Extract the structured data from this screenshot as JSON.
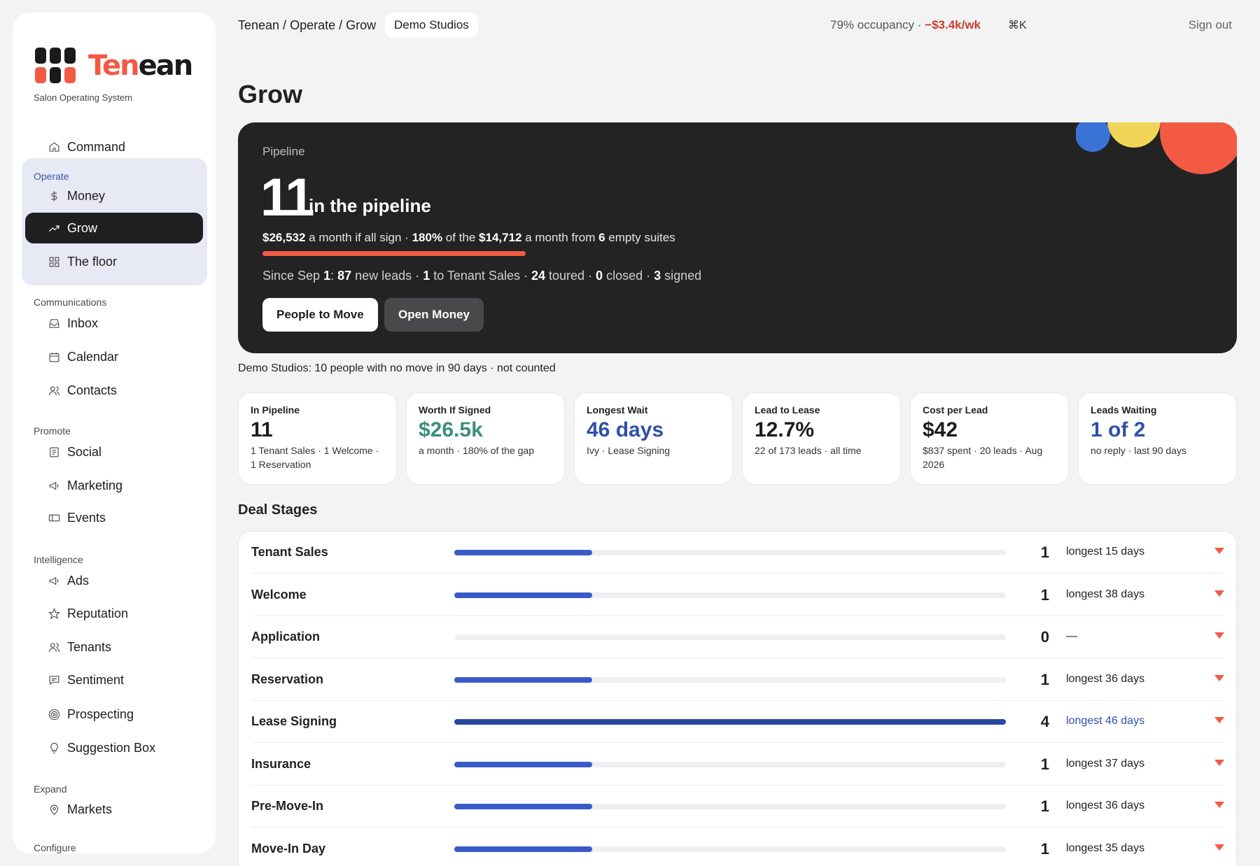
{
  "brand": {
    "name_part1": "Ten",
    "name_part2": "ean",
    "tagline": "Salon Operating System"
  },
  "sidebar": {
    "top_item": {
      "label": "Command",
      "icon": "home-icon"
    },
    "sections": [
      {
        "label": "Operate",
        "items": [
          {
            "label": "Money",
            "icon": "dollar-icon"
          },
          {
            "label": "Grow",
            "icon": "trending-up-icon",
            "active": true
          },
          {
            "label": "The floor",
            "icon": "grid-icon"
          }
        ]
      },
      {
        "label": "Communications",
        "items": [
          {
            "label": "Inbox",
            "icon": "inbox-icon"
          },
          {
            "label": "Calendar",
            "icon": "calendar-icon"
          },
          {
            "label": "Contacts",
            "icon": "users-icon"
          }
        ]
      },
      {
        "label": "Promote",
        "items": [
          {
            "label": "Social",
            "icon": "document-icon"
          },
          {
            "label": "Marketing",
            "icon": "megaphone-icon"
          },
          {
            "label": "Events",
            "icon": "ticket-icon"
          }
        ]
      },
      {
        "label": "Intelligence",
        "items": [
          {
            "label": "Ads",
            "icon": "megaphone-icon"
          },
          {
            "label": "Reputation",
            "icon": "star-icon"
          },
          {
            "label": "Tenants",
            "icon": "users-icon"
          },
          {
            "label": "Sentiment",
            "icon": "chat-icon"
          },
          {
            "label": "Prospecting",
            "icon": "target-icon"
          },
          {
            "label": "Suggestion Box",
            "icon": "lightbulb-icon"
          }
        ]
      },
      {
        "label": "Expand",
        "items": [
          {
            "label": "Markets",
            "icon": "map-pin-icon"
          }
        ]
      },
      {
        "label": "Configure",
        "items": []
      }
    ]
  },
  "topbar": {
    "crumb_root": "Tenean / ",
    "crumb_mid": "Operate / Grow",
    "studio": "Demo Studios",
    "occupancy": "79% occupancy · ",
    "weekly_delta": "−$3.4k/wk",
    "shortcut": "⌘K",
    "signout": "Sign out"
  },
  "page": {
    "title": "Grow"
  },
  "hero": {
    "kicker": "Pipeline",
    "count": "11",
    "count_label": "in the pipeline",
    "money": {
      "potential": "$26,532",
      "t1": " a month if all sign · ",
      "pct": "180%",
      "t2": " of the ",
      "gap": "$14,712",
      "t3": " a month from ",
      "suites": "6",
      "t4": " empty suites"
    },
    "gap_progress": 1.0,
    "since": {
      "t0": "Since Sep ",
      "day": "1",
      "t1": ": ",
      "new_leads": "87",
      "t2": " new leads · ",
      "to_sales": "1",
      "t3": " to Tenant Sales · ",
      "toured": "24",
      "t4": " toured · ",
      "closed": "0",
      "t5": " closed · ",
      "signed": "3",
      "t6": " signed"
    },
    "btn_primary": "People to Move",
    "btn_secondary": "Open Money"
  },
  "note": "Demo Studios: 10 people with no move in 90 days · not counted",
  "kpis": [
    {
      "label": "In Pipeline",
      "value": "11",
      "sub": "1 Tenant Sales · 1 Welcome · 1 Reservation",
      "tone": "dark"
    },
    {
      "label": "Worth If Signed",
      "value": "$26.5k",
      "sub": "a month · 180% of the gap",
      "tone": "green"
    },
    {
      "label": "Longest Wait",
      "value": "46 days",
      "sub": "Ivy · Lease Signing",
      "tone": "blue"
    },
    {
      "label": "Lead to Lease",
      "value": "12.7%",
      "sub": "22 of 173 leads · all time",
      "tone": "dark"
    },
    {
      "label": "Cost per Lead",
      "value": "$42",
      "sub": "$837 spent · 20 leads · Aug 2026",
      "tone": "dark"
    },
    {
      "label": "Leads Waiting",
      "value": "1 of 2",
      "sub": "no reply · last 90 days",
      "tone": "blue"
    }
  ],
  "deal_stages": {
    "title": "Deal Stages",
    "max_count": 4,
    "rows": [
      {
        "name": "Tenant Sales",
        "count": 1,
        "longest": "longest 15 days"
      },
      {
        "name": "Welcome",
        "count": 1,
        "longest": "longest 38 days"
      },
      {
        "name": "Application",
        "count": 0,
        "longest": "—"
      },
      {
        "name": "Reservation",
        "count": 1,
        "longest": "longest 36 days"
      },
      {
        "name": "Lease Signing",
        "count": 4,
        "longest": "longest 46 days",
        "highlight": true
      },
      {
        "name": "Insurance",
        "count": 1,
        "longest": "longest 37 days"
      },
      {
        "name": "Pre-Move-In",
        "count": 1,
        "longest": "longest 36 days"
      },
      {
        "name": "Move-In Day",
        "count": 1,
        "longest": "longest 35 days"
      }
    ]
  },
  "colors": {
    "accent": "#f25a44",
    "blue": "#3050a8",
    "green": "#3c8f7a",
    "dark": "#232324"
  }
}
